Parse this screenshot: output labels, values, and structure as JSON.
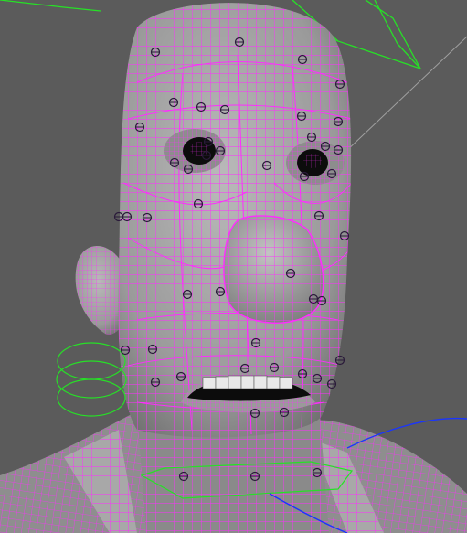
{
  "viewport": {
    "background_color": "#5b5b5b",
    "grid_color": "#a8a8a8"
  },
  "model": {
    "skin_color": "#8c8c8c",
    "skin_light_color": "#b3b3b3",
    "wireframe_color": "#ff2cff",
    "handle_color": "#2a1a3a"
  },
  "rig_controls": {
    "green_color": "#27e027",
    "blue_color": "#1a35ff",
    "ear_ring_control": "ring-control",
    "neck_control": "neck-control",
    "head_top_control": "head-top-control",
    "shoulder_curve": "shoulder-curve"
  },
  "icons": [
    "selection-handle-icon"
  ]
}
